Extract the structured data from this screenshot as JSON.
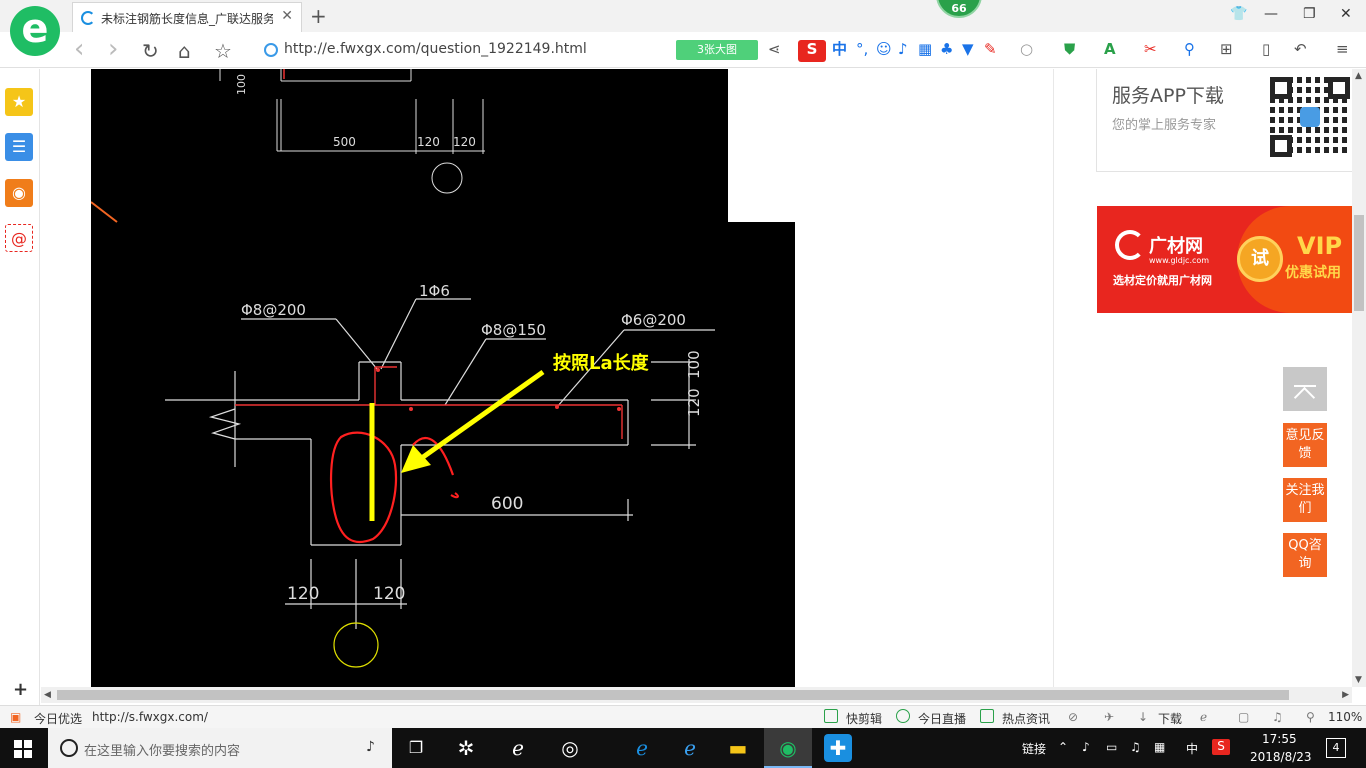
{
  "tab": {
    "title": "未标注钢筋长度信息_广联达服务",
    "close": "✕",
    "new_tab": "+"
  },
  "badge": "66",
  "window": {
    "shirt": "👕",
    "minimize": "—",
    "restore": "❐",
    "close": "✕"
  },
  "nav": {
    "back": "‹",
    "forward": "›",
    "refresh": "↻",
    "home": "⌂",
    "star": "☆",
    "url": "http://e.fwxgx.com/question_1922149.html",
    "bigimg": "3张大图"
  },
  "toolbar_icons": [
    "share-icon",
    "sogou-icon",
    "translate-icon",
    "emoji-icon",
    "mic-icon",
    "keyboard-icon",
    "skin-icon",
    "tools-icon",
    "search-icon",
    "shield-icon",
    "translate-app-icon",
    "cut-icon",
    "find-icon",
    "apps-icon",
    "phone-icon",
    "undo-icon",
    "menu-icon"
  ],
  "sidebar": {
    "add": "+"
  },
  "drawing": {
    "dim_100": "100",
    "dim_500": "500",
    "dim_120a": "120",
    "dim_120b": "120",
    "label_phi8_200": "Φ8@200",
    "label_1phi6": "1Φ6",
    "label_phi8_150": "Φ8@150",
    "label_phi6_200": "Φ6@200",
    "annotation": "按照La长度",
    "dim_100r": "100",
    "dim_120r": "120",
    "dim_600": "600",
    "dim_120c": "120",
    "dim_120d": "120"
  },
  "app_card": {
    "title": "服务APP下载",
    "subtitle": "您的掌上服务专家"
  },
  "ad": {
    "brand": "广材网",
    "domain": "www.gldjc.com",
    "slogan": "选材定价就用广材网",
    "try": "试",
    "vip": "VIP",
    "vip_sub": "优惠试用"
  },
  "float_buttons": [
    {
      "label": "意见反馈"
    },
    {
      "label": "关注我们"
    },
    {
      "label": "QQ咨询"
    }
  ],
  "status": {
    "today": "今日优选",
    "link": "http://s.fwxgx.com/",
    "items": [
      "快剪辑",
      "今日直播",
      "热点资讯"
    ],
    "download": "下载",
    "zoom": "110%"
  },
  "taskbar": {
    "search_placeholder": "在这里输入你要搜索的内容",
    "link": "链接",
    "ime": "中",
    "time": "17:55",
    "date": "2018/8/23",
    "notifications": "4"
  },
  "colors": {
    "green": "#1fbd64",
    "red": "#e8261f",
    "orange": "#f26522",
    "yellow": "#ffff00"
  }
}
